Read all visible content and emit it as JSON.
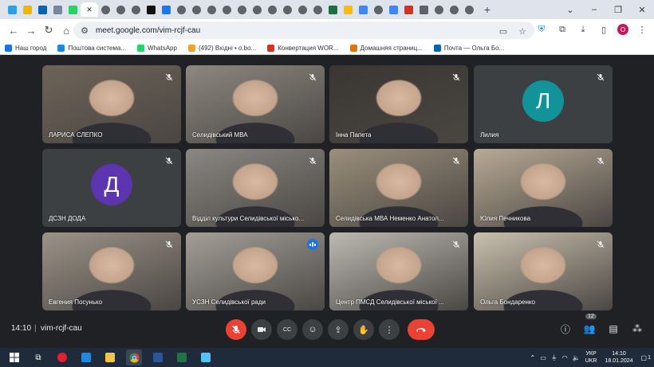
{
  "browser": {
    "url": "meet.google.com/vim-rcjf-cau",
    "tabs": [
      {
        "icon": "telegram-icon",
        "color": "#2aa3e0"
      },
      {
        "icon": "gallery-icon",
        "color": "#f4b400"
      },
      {
        "icon": "outlook-icon",
        "color": "#0a64ad"
      },
      {
        "icon": "photo-icon",
        "color": "#7a869a"
      },
      {
        "icon": "whatsapp-icon",
        "color": "#25d366"
      },
      {
        "icon": "close-icon",
        "color": "#202124",
        "active": true
      },
      {
        "icon": "globe-icon",
        "color": "#5f6368"
      },
      {
        "icon": "globe-icon",
        "color": "#5f6368"
      },
      {
        "icon": "globe-icon",
        "color": "#5f6368"
      },
      {
        "icon": "tiktok-icon",
        "color": "#111111"
      },
      {
        "icon": "facebook-icon",
        "color": "#1877f2"
      },
      {
        "icon": "globe-icon",
        "color": "#5f6368"
      },
      {
        "icon": "globe-icon",
        "color": "#5f6368"
      },
      {
        "icon": "globe-icon",
        "color": "#5f6368"
      },
      {
        "icon": "globe-icon",
        "color": "#5f6368"
      },
      {
        "icon": "globe-icon",
        "color": "#5f6368"
      },
      {
        "icon": "globe-icon",
        "color": "#5f6368"
      },
      {
        "icon": "globe-icon",
        "color": "#5f6368"
      },
      {
        "icon": "globe-icon",
        "color": "#5f6368"
      },
      {
        "icon": "globe-icon",
        "color": "#5f6368"
      },
      {
        "icon": "globe-icon",
        "color": "#5f6368"
      },
      {
        "icon": "excel-icon",
        "color": "#1d6f42"
      },
      {
        "icon": "drive-icon",
        "color": "#fbbc04"
      },
      {
        "icon": "docs-icon",
        "color": "#4285f4"
      },
      {
        "icon": "globe-icon",
        "color": "#5f6368"
      },
      {
        "icon": "docs-icon",
        "color": "#4285f4"
      },
      {
        "icon": "heart-icon",
        "color": "#d93025"
      },
      {
        "icon": "puzzle-icon",
        "color": "#5f6368"
      },
      {
        "icon": "globe-icon",
        "color": "#5f6368"
      },
      {
        "icon": "globe-icon",
        "color": "#5f6368"
      },
      {
        "icon": "globe-icon",
        "color": "#5f6368"
      }
    ],
    "profile_letter": "O"
  },
  "bookmarks": [
    {
      "label": "Наш город",
      "icon": "grid-icon",
      "color": "#1a73e8"
    },
    {
      "label": "Поштова система...",
      "icon": "mail-icon",
      "color": "#1e88e5"
    },
    {
      "label": "WhatsApp",
      "icon": "whatsapp-icon",
      "color": "#25d366"
    },
    {
      "label": "(492) Вхідні • о.bo...",
      "icon": "mail-icon",
      "color": "#e8a33d"
    },
    {
      "label": "Конвертация WOR...",
      "icon": "convert-icon",
      "color": "#d93025"
    },
    {
      "label": "Домашняя страниц...",
      "icon": "home-icon",
      "color": "#e37400"
    },
    {
      "label": "Почта — Ольга Бо...",
      "icon": "outlook-icon",
      "color": "#0a64ad"
    }
  ],
  "participants": [
    {
      "name": "ЛАРИСА СЛЕПКО",
      "muted": true,
      "bg": "#6e6358"
    },
    {
      "name": "Селидівський МВА",
      "muted": true,
      "bg": "#8c8880"
    },
    {
      "name": "Інна Папета",
      "muted": true,
      "bg": "#3a3633"
    },
    {
      "name": "Лилия",
      "muted": true,
      "bg": "#3c4043",
      "avatar_letter": "Л",
      "avatar_color": "#12939a"
    },
    {
      "name": "ДСЗН ДОДА",
      "muted": true,
      "bg": "#3c4043",
      "avatar_letter": "Д",
      "avatar_color": "#5e35b1"
    },
    {
      "name": "Відділ культури Селидівської місько...",
      "muted": true,
      "bg": "#8a8784"
    },
    {
      "name": "Селидівська МВА Неменко Анатол...",
      "muted": true,
      "bg": "#9b8f7c"
    },
    {
      "name": "Юлия Печникова",
      "muted": true,
      "bg": "#b8aa96"
    },
    {
      "name": "Евгения Посунько",
      "muted": true,
      "bg": "#9a9388"
    },
    {
      "name": "УСЗН Селидівської ради",
      "muted": false,
      "speaking": true,
      "bg": "#a39f98"
    },
    {
      "name": "Центр ПМСД Селидівської міської ...",
      "muted": true,
      "bg": "#bdbab3"
    },
    {
      "name": "Ольга Бондаренко",
      "muted": true,
      "bg": "#c9c0ae"
    }
  ],
  "meeting": {
    "time": "14:10",
    "separator": "|",
    "code": "vim-rcjf-cau",
    "participant_count": "12"
  },
  "taskbar": {
    "language_top": "УКР",
    "language_bottom": "UKR",
    "time": "14:10",
    "date": "18.01.2024",
    "notification_count": "1"
  }
}
